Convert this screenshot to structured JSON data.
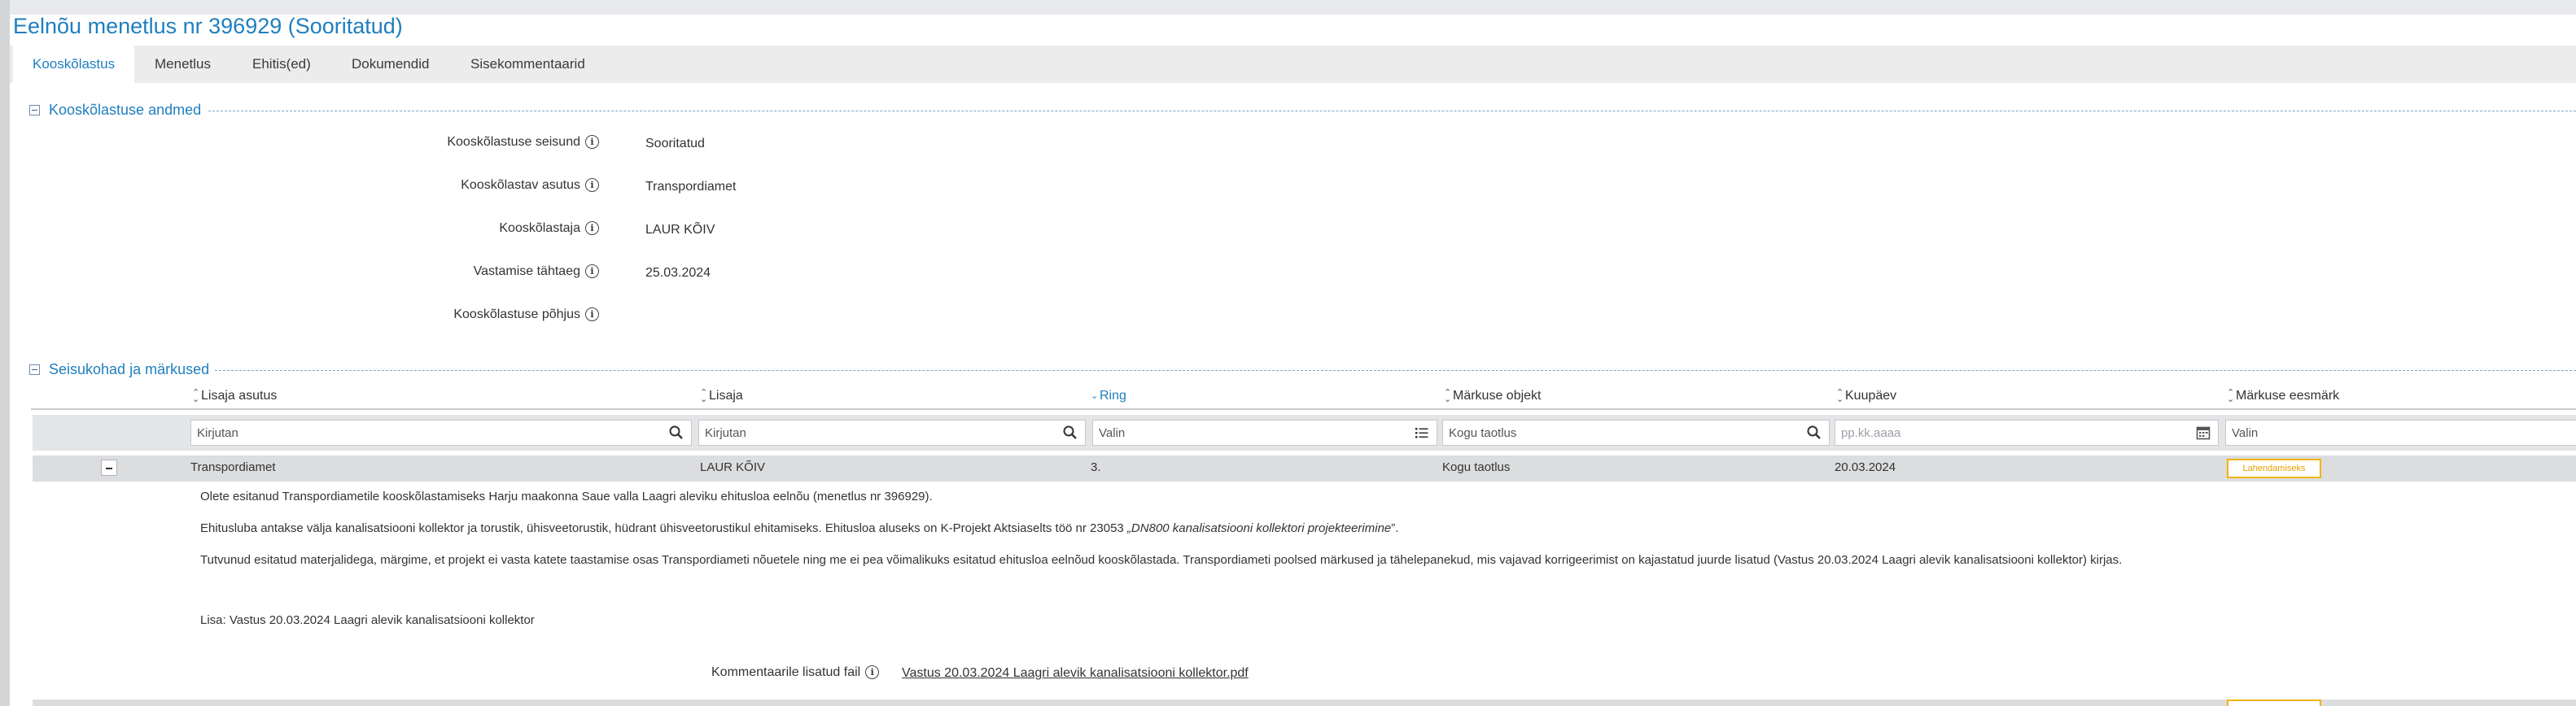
{
  "page": {
    "title": "Eelnõu menetlus nr 396929 (Sooritatud)"
  },
  "tabs": [
    {
      "label": "Kooskõlastus",
      "active": true
    },
    {
      "label": "Menetlus",
      "active": false
    },
    {
      "label": "Ehitis(ed)",
      "active": false
    },
    {
      "label": "Dokumendid",
      "active": false
    },
    {
      "label": "Sisekommentaarid",
      "active": false
    }
  ],
  "coordination": {
    "section_title": "Kooskõlastuse andmed",
    "fields": [
      {
        "label": "Kooskõlastuse seisund",
        "value": "Sooritatud"
      },
      {
        "label": "Kooskõlastav asutus",
        "value": "Transpordiamet"
      },
      {
        "label": "Kooskõlastaja",
        "value": "LAUR KÕIV"
      },
      {
        "label": "Vastamise tähtaeg",
        "value": "25.03.2024"
      },
      {
        "label": "Kooskõlastuse põhjus",
        "value": ""
      }
    ]
  },
  "remarks": {
    "section_title": "Seisukohad ja märkused",
    "columns": [
      "Lisaja asutus",
      "Lisaja",
      "Ring",
      "Märkuse objekt",
      "Kuupäev",
      "Märkuse eesmärk"
    ],
    "sorted_column": "Ring",
    "filters": [
      {
        "value": "Kirjutan",
        "placeholder": false,
        "icon": "search-icon"
      },
      {
        "value": "Kirjutan",
        "placeholder": false,
        "icon": "search-icon"
      },
      {
        "value": "Valin",
        "placeholder": false,
        "icon": "list-icon"
      },
      {
        "value": "Kogu taotlus",
        "placeholder": false,
        "icon": "search-icon"
      },
      {
        "value": "pp.kk.aaaa",
        "placeholder": true,
        "icon": "calendar-icon"
      },
      {
        "value": "Valin",
        "placeholder": false,
        "icon": ""
      }
    ],
    "row": {
      "institution": "Transpordiamet",
      "author": "LAUR KÕIV",
      "round": "3.",
      "object": "Kogu taotlus",
      "date": "20.03.2024",
      "purpose": "Lahendamiseks",
      "purpose_color": "#f0b400",
      "paragraphs": {
        "p1": "Olete esitanud Transpordiametile kooskõlastamiseks Harju maakonna Saue valla Laagri aleviku ehitusloa eelnõu (menetlus nr 396929).",
        "p2_pre": "Ehitusluba antakse välja kanalisatsiooni kollektor ja torustik, ühisveetorustik, hüdrant ühisveetorustikul ehitamiseks. Ehitusloa aluseks on K-Projekt Aktsiaselts töö nr 23053 ",
        "p2_italic": "„DN800 kanalisatsiooni kollektori projekteerimine",
        "p2_post": "”.",
        "p3": "Tutvunud esitatud materjalidega, märgime, et projekt ei vasta katete taastamise osas Transpordiameti nõuetele ning me ei pea võimalikuks esitatud ehitusloa eelnõud kooskõlastada. Transpordiameti poolsed märkused ja tähelepanekud, mis vajavad korrigeerimist on kajastatud juurde lisatud (Vastus 20.03.2024 Laagri alevik kanalisatsiooni kollektor) kirjas.",
        "p4": "Lisa: Vastus 20.03.2024 Laagri alevik kanalisatsiooni kollektor"
      },
      "file_label": "Kommentaarile lisatud fail",
      "file_name": "Vastus 20.03.2024 Laagri alevik kanalisatsiooni kollektor.pdf"
    }
  },
  "colors": {
    "accent": "#1f7fbf",
    "badge": "#f0b400"
  }
}
